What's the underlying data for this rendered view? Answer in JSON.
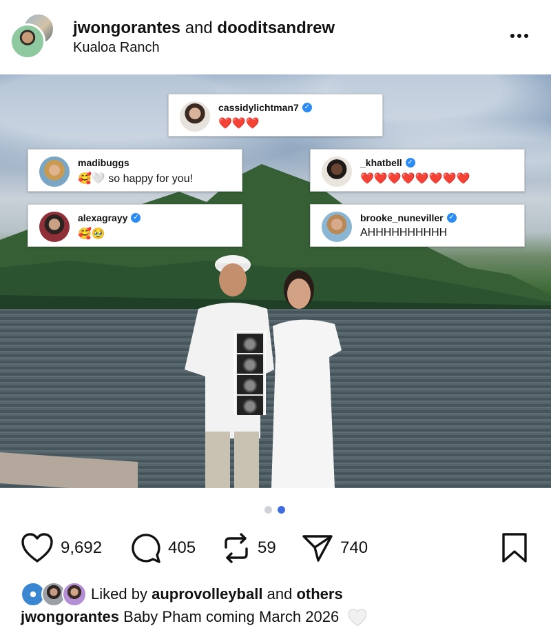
{
  "header": {
    "user1": "jwongorantes",
    "joiner": "and",
    "user2": "dooditsandrew",
    "location": "Kualoa Ranch"
  },
  "comments": [
    {
      "username": "cassidylichtman7",
      "verified": true,
      "text": "❤️❤️❤️"
    },
    {
      "username": "madibuggs",
      "verified": false,
      "text": "🥰🤍 so happy for you!"
    },
    {
      "username": "_khatbell",
      "verified": true,
      "text": "❤️❤️❤️❤️❤️❤️❤️❤️"
    },
    {
      "username": "alexagrayy",
      "verified": true,
      "text": "🥰🥹"
    },
    {
      "username": "brooke_nuneviller",
      "verified": true,
      "text": "AHHHHHHHHHH"
    }
  ],
  "carousel": {
    "total": 2,
    "active": 2
  },
  "actions": {
    "likes": "9,692",
    "comments": "405",
    "reposts": "59",
    "shares": "740"
  },
  "liked_by": {
    "prefix": "Liked by",
    "user": "auprovolleyball",
    "joiner": "and",
    "others": "others"
  },
  "caption": {
    "username": "jwongorantes",
    "text": "Baby Pham coming March 2026"
  },
  "colors": {
    "accent_dot": "#3f6ce1",
    "verified": "#2b8cf5"
  }
}
